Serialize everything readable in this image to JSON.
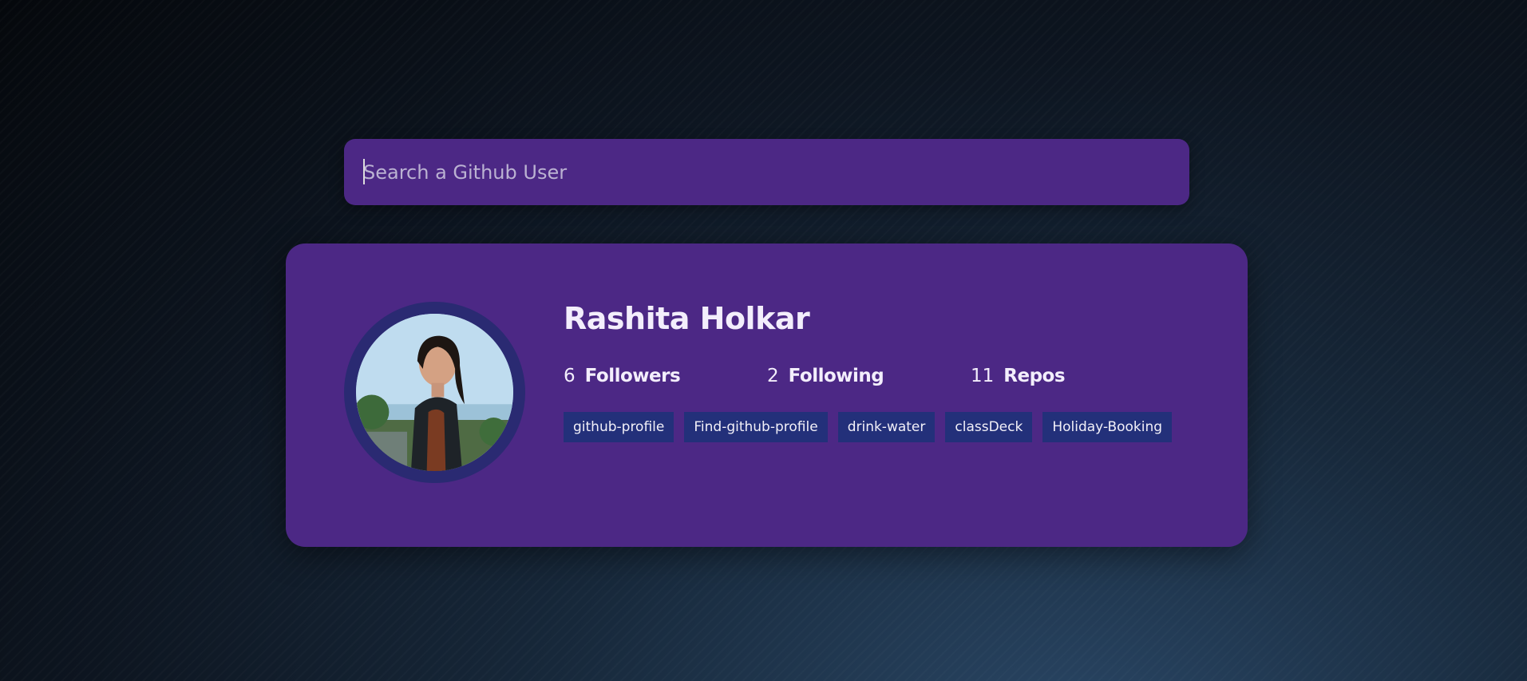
{
  "search": {
    "placeholder": "Search a Github User",
    "value": ""
  },
  "profile": {
    "name": "Rashita Holkar",
    "avatar_alt": "avatar",
    "stats": [
      {
        "value": "6",
        "label": "Followers"
      },
      {
        "value": "2",
        "label": "Following"
      },
      {
        "value": "11",
        "label": "Repos"
      }
    ],
    "repos": [
      "github-profile",
      "Find-github-profile",
      "drink-water",
      "classDeck",
      "Holiday-Booking"
    ]
  },
  "colors": {
    "card": "#4c2885",
    "avatar_ring": "#2a2a72",
    "repo_badge": "#23307a",
    "text": "#f3eefc"
  },
  "icons": {
    "avatar": "person-photo"
  }
}
